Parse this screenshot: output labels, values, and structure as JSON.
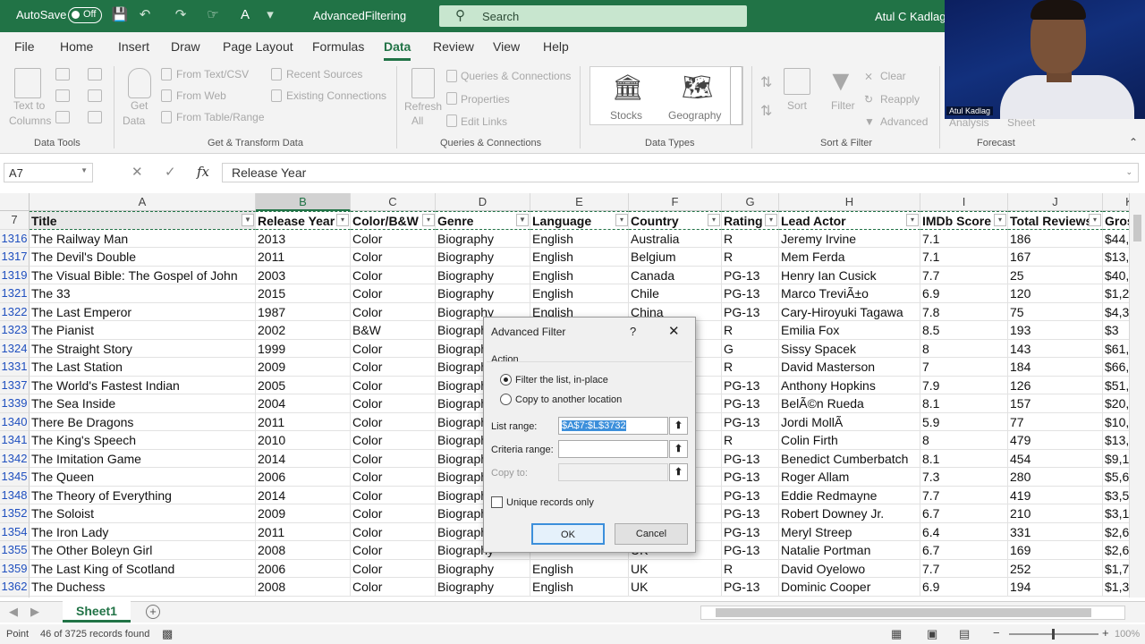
{
  "titlebar": {
    "autosave_label": "AutoSave",
    "autosave_state": "Off",
    "document_name": "AdvancedFiltering",
    "search_placeholder": "Search",
    "user_name": "Atul C Kadlag"
  },
  "tabs": [
    "File",
    "Home",
    "Insert",
    "Draw",
    "Page Layout",
    "Formulas",
    "Data",
    "Review",
    "View",
    "Help"
  ],
  "active_tab": "Data",
  "ribbon": {
    "text_to_columns_1": "Text to",
    "text_to_columns_2": "Columns",
    "get_data_1": "Get",
    "get_data_2": "Data",
    "from_text_csv": "From Text/CSV",
    "from_web": "From Web",
    "from_table_range": "From Table/Range",
    "recent_sources": "Recent Sources",
    "existing_connections": "Existing Connections",
    "refresh_all_1": "Refresh",
    "refresh_all_2": "All",
    "queries_connections": "Queries & Connections",
    "properties": "Properties",
    "edit_links": "Edit Links",
    "stocks": "Stocks",
    "geography": "Geography",
    "sort": "Sort",
    "filter": "Filter",
    "clear": "Clear",
    "reapply": "Reapply",
    "advanced": "Advanced",
    "analysis": "Analysis",
    "sheet": "Sheet",
    "groups": {
      "data_tools": "Data Tools",
      "get_transform": "Get & Transform Data",
      "queries": "Queries & Connections",
      "data_types": "Data Types",
      "sort_filter": "Sort & Filter",
      "forecast": "Forecast"
    }
  },
  "formula_bar": {
    "name_box": "A7",
    "fx": "fx",
    "content": "Release Year"
  },
  "columns": [
    "A",
    "B",
    "C",
    "D",
    "E",
    "F",
    "G",
    "H",
    "I",
    "J",
    "K"
  ],
  "header_row": {
    "row_number": "7",
    "cells": [
      "Title",
      "Release Year",
      "Color/B&W",
      "Genre",
      "Language",
      "Country",
      "Rating",
      "Lead Actor",
      "IMDb Score",
      "Total Reviews",
      "Gros"
    ]
  },
  "rows": [
    {
      "n": "1316",
      "c": [
        "The Railway Man",
        "2013",
        "Color",
        "Biography",
        "English",
        "Australia",
        "R",
        "Jeremy Irvine",
        "7.1",
        "186",
        "$44,"
      ]
    },
    {
      "n": "1317",
      "c": [
        "The Devil's Double",
        "2011",
        "Color",
        "Biography",
        "English",
        "Belgium",
        "R",
        "Mem Ferda",
        "7.1",
        "167",
        "$13,"
      ]
    },
    {
      "n": "1319",
      "c": [
        "The Visual Bible: The Gospel of John",
        "2003",
        "Color",
        "Biography",
        "English",
        "Canada",
        "PG-13",
        "Henry Ian Cusick",
        "7.7",
        "25",
        "$40,"
      ]
    },
    {
      "n": "1321",
      "c": [
        "The 33",
        "2015",
        "Color",
        "Biography",
        "English",
        "Chile",
        "PG-13",
        "Marco TreviÃ±o",
        "6.9",
        "120",
        "$1,2"
      ]
    },
    {
      "n": "1322",
      "c": [
        "The Last Emperor",
        "1987",
        "Color",
        "Biography",
        "English",
        "China",
        "PG-13",
        "Cary-Hiroyuki Tagawa",
        "7.8",
        "75",
        "$4,3"
      ]
    },
    {
      "n": "1323",
      "c": [
        "The Pianist",
        "2002",
        "B&W",
        "Biography",
        "",
        "",
        "R",
        "Emilia Fox",
        "8.5",
        "193",
        "$3"
      ]
    },
    {
      "n": "1324",
      "c": [
        "The Straight Story",
        "1999",
        "Color",
        "Biography",
        "",
        "",
        "G",
        "Sissy Spacek",
        "8",
        "143",
        "$61,"
      ]
    },
    {
      "n": "1331",
      "c": [
        "The Last Station",
        "2009",
        "Color",
        "Biography",
        "",
        "",
        "R",
        "David Masterson",
        "7",
        "184",
        "$66,"
      ]
    },
    {
      "n": "1337",
      "c": [
        "The World's Fastest Indian",
        "2005",
        "Color",
        "Biography",
        "",
        "d",
        "PG-13",
        "Anthony Hopkins",
        "7.9",
        "126",
        "$51,"
      ]
    },
    {
      "n": "1339",
      "c": [
        "The Sea Inside",
        "2004",
        "Color",
        "Biography",
        "",
        "",
        "PG-13",
        "BelÃ©n Rueda",
        "8.1",
        "157",
        "$20,"
      ]
    },
    {
      "n": "1340",
      "c": [
        "There Be Dragons",
        "2011",
        "Color",
        "Biography",
        "",
        "",
        "PG-13",
        "Jordi MollÃ",
        "5.9",
        "77",
        "$10,"
      ]
    },
    {
      "n": "1341",
      "c": [
        "The King's Speech",
        "2010",
        "Color",
        "Biography",
        "",
        "",
        "R",
        "Colin Firth",
        "8",
        "479",
        "$13,"
      ]
    },
    {
      "n": "1342",
      "c": [
        "The Imitation Game",
        "2014",
        "Color",
        "Biography",
        "",
        "",
        "PG-13",
        "Benedict Cumberbatch",
        "8.1",
        "454",
        "$9,1"
      ]
    },
    {
      "n": "1345",
      "c": [
        "The Queen",
        "2006",
        "Color",
        "Biography",
        "",
        "",
        "PG-13",
        "Roger Allam",
        "7.3",
        "280",
        "$5,6"
      ]
    },
    {
      "n": "1348",
      "c": [
        "The Theory of Everything",
        "2014",
        "Color",
        "Biography",
        "",
        "",
        "PG-13",
        "Eddie Redmayne",
        "7.7",
        "419",
        "$3,5"
      ]
    },
    {
      "n": "1352",
      "c": [
        "The Soloist",
        "2009",
        "Color",
        "Biography",
        "",
        "",
        "PG-13",
        "Robert Downey Jr.",
        "6.7",
        "210",
        "$3,1"
      ]
    },
    {
      "n": "1354",
      "c": [
        "The Iron Lady",
        "2011",
        "Color",
        "Biography",
        "",
        "",
        "PG-13",
        "Meryl Streep",
        "6.4",
        "331",
        "$2,6"
      ]
    },
    {
      "n": "1355",
      "c": [
        "The Other Boleyn Girl",
        "2008",
        "Color",
        "Biography",
        "",
        "UK",
        "PG-13",
        "Natalie Portman",
        "6.7",
        "169",
        "$2,6"
      ]
    },
    {
      "n": "1359",
      "c": [
        "The Last King of Scotland",
        "2006",
        "Color",
        "Biography",
        "English",
        "UK",
        "R",
        "David Oyelowo",
        "7.7",
        "252",
        "$1,7"
      ]
    },
    {
      "n": "1362",
      "c": [
        "The Duchess",
        "2008",
        "Color",
        "Biography",
        "English",
        "UK",
        "PG-13",
        "Dominic Cooper",
        "6.9",
        "194",
        "$1,3"
      ]
    }
  ],
  "sheet_tab": "Sheet1",
  "status": {
    "mode": "Point",
    "records": "46 of 3725 records found",
    "zoom": "100%"
  },
  "dialog": {
    "title": "Advanced Filter",
    "help": "?",
    "close": "✕",
    "action_label": "Action",
    "option_inplace": "Filter the list, in-place",
    "option_copy": "Copy to another location",
    "list_range_label": "List range:",
    "list_range_value": "$A$7:$L$3732",
    "criteria_range_label": "Criteria range:",
    "criteria_range_value": "",
    "copy_to_label": "Copy to:",
    "copy_to_value": "",
    "unique_label": "Unique records only",
    "ok": "OK",
    "cancel": "Cancel"
  },
  "webcam": {
    "name": "Atul Kadlag"
  }
}
